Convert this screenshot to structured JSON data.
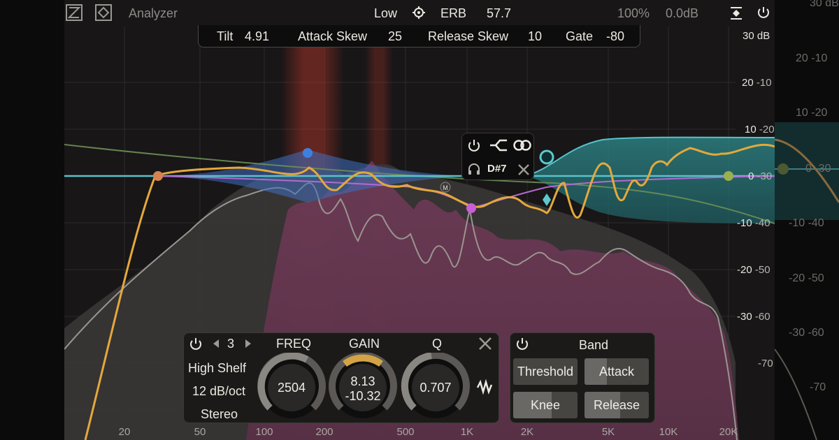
{
  "app": {
    "title": "Analyzer"
  },
  "header": {
    "resolution": "Low",
    "scale_mode": "ERB",
    "scale_value": "57.7",
    "zoom": "100%",
    "output_gain": "0.0dB"
  },
  "analyzer_settings": {
    "tilt_label": "Tilt",
    "tilt_value": "4.91",
    "attack_skew_label": "Attack Skew",
    "attack_skew_value": "25",
    "release_skew_label": "Release Skew",
    "release_skew_value": "10",
    "gate_label": "Gate",
    "gate_value": "-80"
  },
  "y_axis": {
    "top_label": "30 dB",
    "ticks": [
      {
        "db": "20",
        "sub": "-10"
      },
      {
        "db": "10",
        "sub": "-20"
      },
      {
        "db": "0",
        "sub": "-30"
      },
      {
        "db": "-10",
        "sub": "-40"
      },
      {
        "db": "-20",
        "sub": "-50"
      },
      {
        "db": "-30",
        "sub": "-60"
      },
      {
        "db": "",
        "sub": "-70"
      }
    ]
  },
  "x_axis": {
    "ticks": [
      "20",
      "50",
      "100",
      "200",
      "500",
      "1K",
      "2K",
      "5K",
      "10K",
      "20K"
    ]
  },
  "side_labels": {
    "left": [],
    "right": [
      "30 dB",
      "20 -10",
      "10 -20",
      "0 -30",
      "-10 -40",
      "-20 -50",
      "-30 -60",
      "-70"
    ]
  },
  "band_popup": {
    "note": "D#7"
  },
  "band_panel": {
    "band_number": "3",
    "filter_type": "High Shelf",
    "slope": "12 dB/oct",
    "channel": "Stereo",
    "freq_label": "FREQ",
    "freq_value": "2504",
    "gain_label": "GAIN",
    "gain_value_top": "8.13",
    "gain_value_bottom": "-10.32",
    "q_label": "Q",
    "q_value": "0.707"
  },
  "dynamics_panel": {
    "title": "Band",
    "threshold_label": "Threshold",
    "attack_label": "Attack",
    "knee_label": "Knee",
    "release_label": "Release",
    "threshold_fill": 0.0,
    "attack_fill": 0.35,
    "knee_fill": 0.6,
    "release_fill": 0.55
  },
  "colors": {
    "band_orange": "#d7834f",
    "band_blue": "#3f7fe0",
    "band_purple": "#c95fd6",
    "band_teal": "#5cc9cf",
    "band_olive": "#9bb04e",
    "eq_curve": "#e3a93b",
    "gain_knob_arc": "#d3a346",
    "teal_curve": "#58c3cb"
  }
}
